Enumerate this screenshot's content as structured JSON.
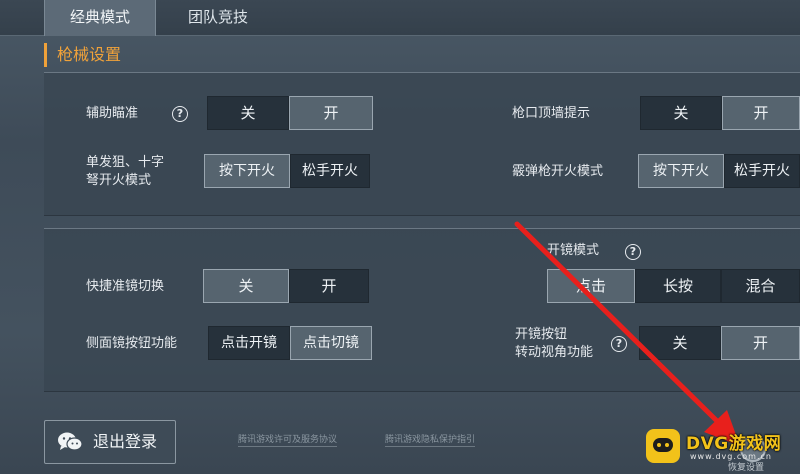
{
  "tabs": [
    {
      "label": "经典模式",
      "active": true
    },
    {
      "label": "团队竞技",
      "active": false
    }
  ],
  "section_title": "枪械设置",
  "settings": {
    "aim_assist": {
      "label": "辅助瞄准",
      "options": [
        "关",
        "开"
      ],
      "selected": "开"
    },
    "muzzle_hint": {
      "label": "枪口顶墙提示",
      "options": [
        "关",
        "开"
      ],
      "selected": "开"
    },
    "single_fire": {
      "label_line1": "单发狙、十字",
      "label_line2": "弩开火模式",
      "options": [
        "按下开火",
        "松手开火"
      ],
      "selected": "按下开火"
    },
    "shotgun_fire": {
      "label": "霰弹枪开火模式",
      "options": [
        "按下开火",
        "松手开火"
      ],
      "selected": "按下开火"
    },
    "quick_scope": {
      "label": "快捷准镜切换",
      "options": [
        "关",
        "开"
      ],
      "selected": "关"
    },
    "scope_mode": {
      "label": "开镜模式",
      "options": [
        "点击",
        "长按",
        "混合"
      ],
      "selected": "点击"
    },
    "side_scope": {
      "label": "侧面镜按钮功能",
      "options": [
        "点击开镜",
        "点击切镜"
      ],
      "selected": "点击切镜"
    },
    "scope_rotate": {
      "label_line1": "开镜按钮",
      "label_line2": "转动视角功能",
      "options": [
        "关",
        "开"
      ],
      "selected": "开"
    }
  },
  "footer": {
    "logout_label": "退出登录",
    "link1": "腾讯游戏许可及服务协议",
    "link2": "腾讯游戏隐私保护指引",
    "feedback_label": "恢复设置"
  },
  "watermark": {
    "brand": "DVG游戏网",
    "domain": "www.dvg.com.cn"
  },
  "colors": {
    "accent": "#f0a23a",
    "arrow": "#e8201c",
    "watermark": "#f2c21a"
  },
  "icons": {
    "help": "question-circle-icon",
    "logout": "wechat-icon",
    "feedback": "feedback-icon",
    "arrow": "red-arrow"
  }
}
